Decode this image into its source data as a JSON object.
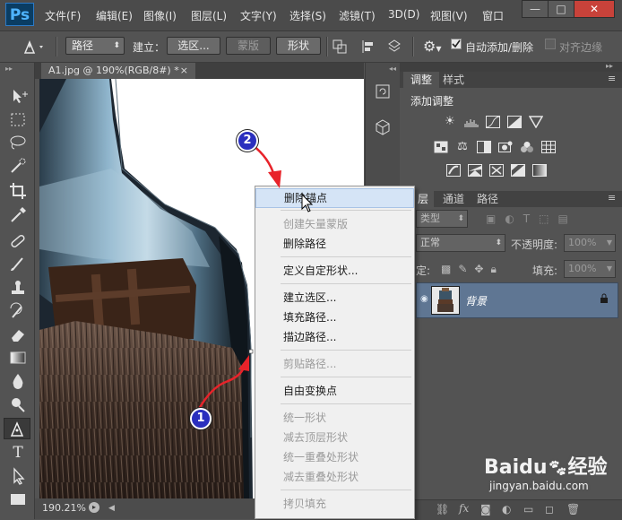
{
  "app": {
    "logo": "Ps"
  },
  "menubar": {
    "items": [
      "文件(F)",
      "编辑(E)",
      "图像(I)",
      "图层(L)",
      "文字(Y)",
      "选择(S)",
      "滤镜(T)",
      "3D(D)",
      "视图(V)",
      "窗口"
    ],
    "window_controls": [
      "—",
      "□",
      "✕"
    ]
  },
  "options": {
    "mode_value": "路径",
    "make_label": "建立：",
    "selection_button": "选区...",
    "mask_button": "蒙版",
    "shape_button": "形状",
    "auto_add_delete_label": "自动添加/删除",
    "auto_add_delete_checked": true,
    "align_edges_label": "对齐边缘",
    "align_edges_checked": false
  },
  "document": {
    "tab_title": "A1.jpg @ 190%(RGB/8#) *",
    "tab_close": "×",
    "zoom": "190.21%"
  },
  "panels": {
    "adjustments": {
      "tabs": [
        "调整",
        "样式"
      ],
      "add_adjustment_label": "添加调整",
      "icons": [
        "brightness-icon",
        "levels-icon",
        "curves-icon",
        "exposure-icon",
        "vibrance-icon",
        "hue-saturation-icon",
        "color-balance-icon",
        "black-white-icon",
        "photo-filter-icon",
        "channel-mixer-icon",
        "color-lookup-icon",
        "invert-icon",
        "posterize-icon",
        "threshold-icon",
        "selective-color-icon",
        "gradient-map-icon"
      ]
    },
    "layers": {
      "tabs": [
        "层",
        "通道",
        "路径"
      ],
      "filter_kind": "类型",
      "blend_mode": "正常",
      "opacity_label": "不透明度:",
      "opacity_value": "100%",
      "lock_label": "定:",
      "fill_label": "填充:",
      "fill_value": "100%",
      "layer_name": "背景"
    }
  },
  "context_menu": {
    "items": [
      {
        "label": "删除锚点",
        "enabled": true,
        "highlighted": true
      },
      {
        "label": "创建矢量蒙版",
        "enabled": false
      },
      {
        "label": "删除路径",
        "enabled": true
      },
      {
        "label": "定义自定形状...",
        "enabled": true
      },
      {
        "label": "建立选区...",
        "enabled": true
      },
      {
        "label": "填充路径...",
        "enabled": true
      },
      {
        "label": "描边路径...",
        "enabled": true
      },
      {
        "label": "剪贴路径...",
        "enabled": false
      },
      {
        "label": "自由变换点",
        "enabled": true
      },
      {
        "label": "统一形状",
        "enabled": false
      },
      {
        "label": "减去顶层形状",
        "enabled": false
      },
      {
        "label": "统一重叠处形状",
        "enabled": false
      },
      {
        "label": "减去重叠处形状",
        "enabled": false
      },
      {
        "label": "拷贝填充",
        "enabled": false
      }
    ]
  },
  "annotations": {
    "step1": "1",
    "step2": "2"
  },
  "watermark": {
    "brand": "Baidu",
    "brand_cn": "经验",
    "url": "jingyan.baidu.com"
  },
  "colors": {
    "annotation_arrow": "#e8232a",
    "badge": "#2a2fbe",
    "menu_highlight": "#d5e4f6"
  }
}
